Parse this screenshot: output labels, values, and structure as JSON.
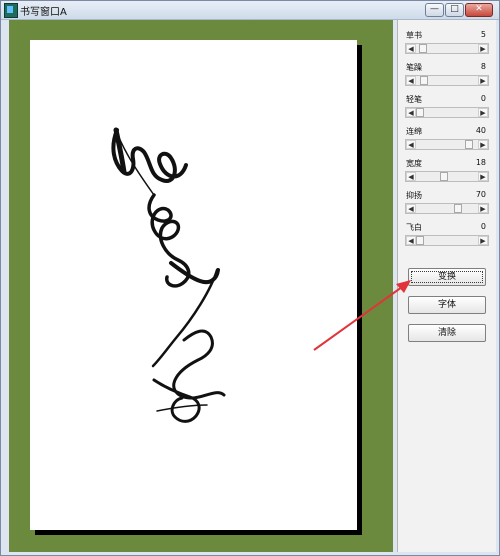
{
  "window": {
    "title": "书写窗口A",
    "controls": {
      "minimize": "—",
      "maximize": "□",
      "close": "✕"
    }
  },
  "panel": {
    "sliders": [
      {
        "label": "草书",
        "value": "5",
        "level": 0.05
      },
      {
        "label": "笔躁",
        "value": "8",
        "level": 0.08
      },
      {
        "label": "轻笔",
        "value": "0",
        "level": 0.0
      },
      {
        "label": "连绵",
        "value": "40",
        "level": 0.9
      },
      {
        "label": "宽度",
        "value": "18",
        "level": 0.45
      },
      {
        "label": "抑扬",
        "value": "70",
        "level": 0.7
      },
      {
        "label": "飞白",
        "value": "0",
        "level": 0.0
      }
    ],
    "buttons": {
      "transform": "变换",
      "font": "字体",
      "clear": "清除"
    }
  },
  "colors": {
    "canvas_bg": "#6b8a3d",
    "annotation_arrow": "#e0343a"
  }
}
